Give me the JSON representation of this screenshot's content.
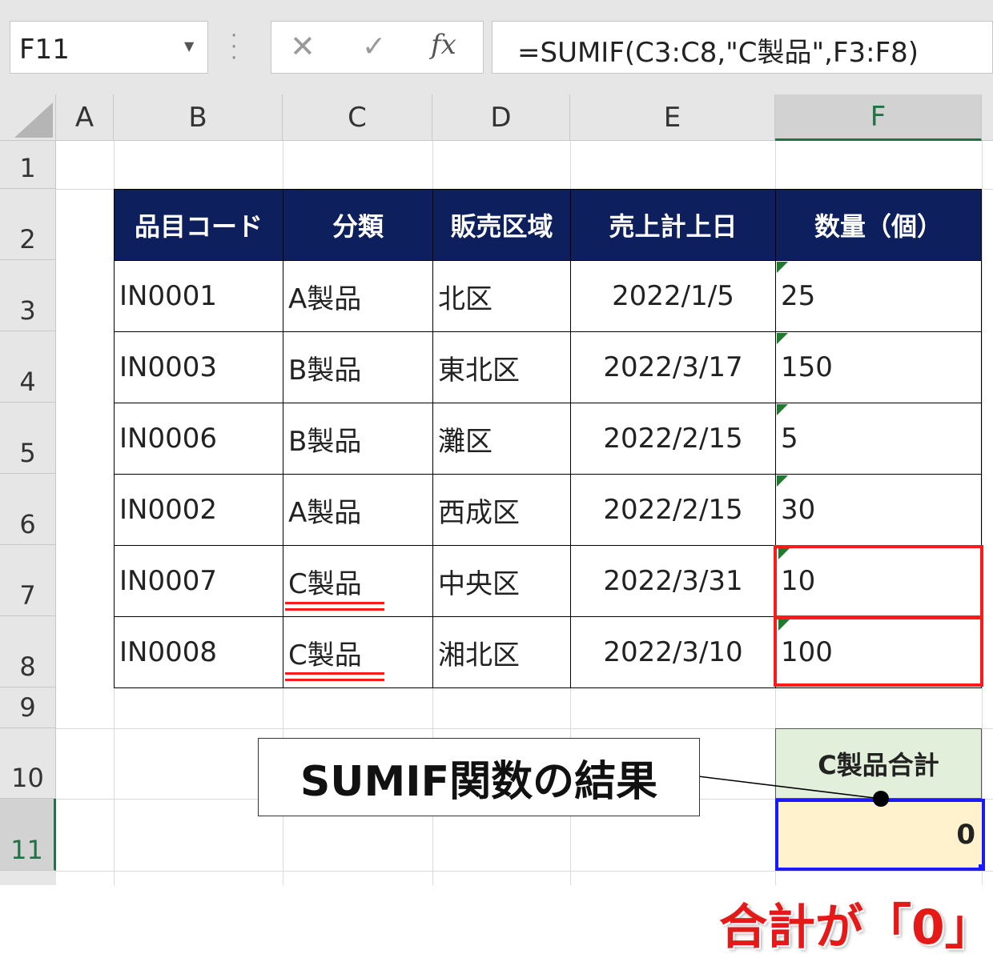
{
  "formula_bar": {
    "name_box": "F11",
    "cancel_icon": "✕",
    "enter_icon": "✓",
    "fx_label": "fx",
    "formula": "=SUMIF(C3:C8,\"C製品\",F3:F8)"
  },
  "columns": [
    "A",
    "B",
    "C",
    "D",
    "E",
    "F"
  ],
  "rows": [
    "1",
    "2",
    "3",
    "4",
    "5",
    "6",
    "7",
    "8",
    "9",
    "10",
    "11"
  ],
  "table": {
    "headers": [
      "品目コード",
      "分類",
      "販売区域",
      "売上計上日",
      "数量（個）"
    ],
    "rows": [
      [
        "IN0001",
        "A製品",
        "北区",
        "2022/1/5",
        "25"
      ],
      [
        "IN0003",
        "B製品",
        "東北区",
        "2022/3/17",
        "150"
      ],
      [
        "IN0006",
        "B製品",
        "灘区",
        "2022/2/15",
        "5"
      ],
      [
        "IN0002",
        "A製品",
        "西成区",
        "2022/2/15",
        "30"
      ],
      [
        "IN0007",
        "C製品",
        "中央区",
        "2022/3/31",
        "10"
      ],
      [
        "IN0008",
        "C製品",
        "湘北区",
        "2022/3/10",
        "100"
      ]
    ]
  },
  "summary": {
    "label": "C製品合計",
    "value": "0"
  },
  "annotations": {
    "callout": "SUMIF関数の結果",
    "result_note": "合計が「0」"
  },
  "colors": {
    "header_bg": "#0d1f5c",
    "highlight_red": "#ff1a1a",
    "highlight_blue": "#1a1aff",
    "summary_label_bg": "#e2efda",
    "summary_value_bg": "#fff2cc"
  }
}
